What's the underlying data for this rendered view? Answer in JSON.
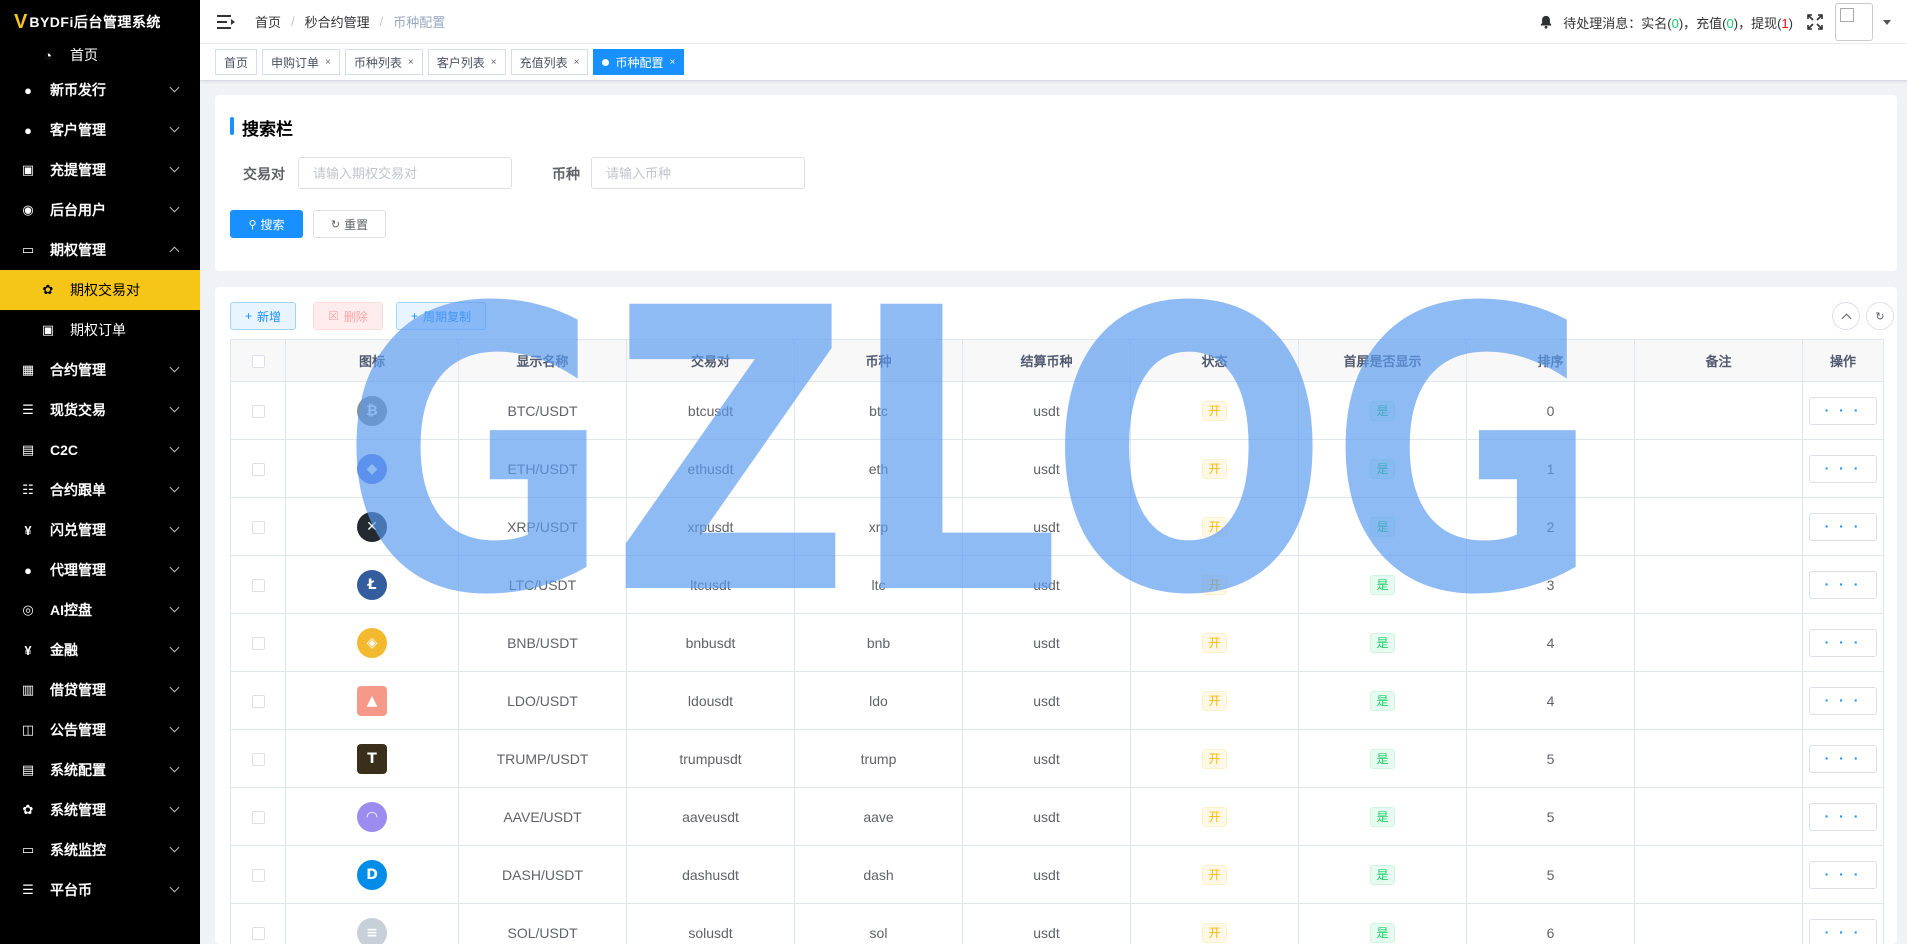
{
  "app": {
    "logo_mark": "V",
    "logo_text": "BYDFi后台管理系统"
  },
  "sidebar": {
    "items": [
      {
        "label": "首页",
        "icon": "dashboard-icon",
        "type": "home"
      },
      {
        "label": "新币发行",
        "icon": "user-icon",
        "type": "group"
      },
      {
        "label": "客户管理",
        "icon": "user-icon",
        "type": "group"
      },
      {
        "label": "充提管理",
        "icon": "copy-icon",
        "type": "group"
      },
      {
        "label": "后台用户",
        "icon": "users-icon",
        "type": "group"
      },
      {
        "label": "期权管理",
        "icon": "monitor-icon",
        "type": "group-open"
      },
      {
        "label": "期权交易对",
        "icon": "gear-icon",
        "type": "active"
      },
      {
        "label": "期权订单",
        "icon": "copy-icon",
        "type": "sub"
      },
      {
        "label": "合约管理",
        "icon": "table-icon",
        "type": "group"
      },
      {
        "label": "现货交易",
        "icon": "list-icon",
        "type": "group"
      },
      {
        "label": "C2C",
        "icon": "document-icon",
        "type": "group"
      },
      {
        "label": "合约跟单",
        "icon": "checklist-icon",
        "type": "group"
      },
      {
        "label": "闪兑管理",
        "icon": "yen-icon",
        "type": "group"
      },
      {
        "label": "代理管理",
        "icon": "user-icon",
        "type": "group"
      },
      {
        "label": "AI控盘",
        "icon": "robot-icon",
        "type": "group"
      },
      {
        "label": "金融",
        "icon": "yen-icon",
        "type": "group"
      },
      {
        "label": "借贷管理",
        "icon": "book-icon",
        "type": "group"
      },
      {
        "label": "公告管理",
        "icon": "open-book-icon",
        "type": "group"
      },
      {
        "label": "系统配置",
        "icon": "document-icon",
        "type": "group"
      },
      {
        "label": "系统管理",
        "icon": "gear-icon",
        "type": "group"
      },
      {
        "label": "系统监控",
        "icon": "monitor-icon",
        "type": "group"
      },
      {
        "label": "平台币",
        "icon": "list-icon",
        "type": "group"
      }
    ]
  },
  "breadcrumb": [
    "首页",
    "秒合约管理",
    "币种配置"
  ],
  "notice": {
    "prefix": "待处理消息：实名(",
    "realname_count": "0",
    "recharge_label": ")，充值(",
    "recharge_count": "0",
    "withdraw_label": ")，提现(",
    "withdraw_count": "1",
    "suffix": ")"
  },
  "tabs": [
    {
      "label": "首页",
      "closable": false,
      "active": false
    },
    {
      "label": "申购订单",
      "closable": true,
      "active": false
    },
    {
      "label": "币种列表",
      "closable": true,
      "active": false
    },
    {
      "label": "客户列表",
      "closable": true,
      "active": false
    },
    {
      "label": "充值列表",
      "closable": true,
      "active": false
    },
    {
      "label": "币种配置",
      "closable": true,
      "active": true
    }
  ],
  "search": {
    "title": "搜索栏",
    "pair_label": "交易对",
    "pair_placeholder": "请输入期权交易对",
    "coin_label": "币种",
    "coin_placeholder": "请输入币种",
    "search_button": "搜索",
    "reset_button": "重置"
  },
  "toolbar": {
    "add_label": "新增",
    "delete_label": "删除",
    "copy_label": "周期复制"
  },
  "table": {
    "columns": [
      "图标",
      "显示名称",
      "交易对",
      "币种",
      "结算币种",
      "状态",
      "首屏是否显示",
      "排序",
      "备注",
      "操作"
    ],
    "rows": [
      {
        "icon": "bitcoin-icon",
        "glyph": "₿",
        "color": "#8e8e8e",
        "name": "BTC/USDT",
        "pair": "btcusdt",
        "coin": "btc",
        "settle": "usdt",
        "status": "开",
        "home": "是",
        "sort": "0",
        "remark": ""
      },
      {
        "icon": "ethereum-icon",
        "glyph": "◆",
        "color": "#627eea",
        "name": "ETH/USDT",
        "pair": "ethusdt",
        "coin": "eth",
        "settle": "usdt",
        "status": "开",
        "home": "是",
        "sort": "1",
        "remark": ""
      },
      {
        "icon": "xrp-icon",
        "glyph": "✕",
        "color": "#23292f",
        "name": "XRP/USDT",
        "pair": "xrpusdt",
        "coin": "xrp",
        "settle": "usdt",
        "status": "开",
        "home": "是",
        "sort": "2",
        "remark": ""
      },
      {
        "icon": "litecoin-icon",
        "glyph": "Ł",
        "color": "#345d9d",
        "name": "LTC/USDT",
        "pair": "ltcusdt",
        "coin": "ltc",
        "settle": "usdt",
        "status": "开",
        "home": "是",
        "sort": "3",
        "remark": ""
      },
      {
        "icon": "bnb-icon",
        "glyph": "◈",
        "color": "#f3ba2f",
        "name": "BNB/USDT",
        "pair": "bnbusdt",
        "coin": "bnb",
        "settle": "usdt",
        "status": "开",
        "home": "是",
        "sort": "4",
        "remark": ""
      },
      {
        "icon": "lido-icon",
        "glyph": "▲",
        "color": "#f69988",
        "name": "LDO/USDT",
        "pair": "ldousdt",
        "coin": "ldo",
        "settle": "usdt",
        "status": "开",
        "home": "是",
        "sort": "4",
        "remark": ""
      },
      {
        "icon": "trump-icon",
        "glyph": "T",
        "color": "#3a2f1a",
        "name": "TRUMP/USDT",
        "pair": "trumpusdt",
        "coin": "trump",
        "settle": "usdt",
        "status": "开",
        "home": "是",
        "sort": "5",
        "remark": ""
      },
      {
        "icon": "aave-icon",
        "glyph": "◠",
        "color": "#9c8cf0",
        "name": "AAVE/USDT",
        "pair": "aaveusdt",
        "coin": "aave",
        "settle": "usdt",
        "status": "开",
        "home": "是",
        "sort": "5",
        "remark": ""
      },
      {
        "icon": "dash-icon",
        "glyph": "D",
        "color": "#008ce7",
        "name": "DASH/USDT",
        "pair": "dashusdt",
        "coin": "dash",
        "settle": "usdt",
        "status": "开",
        "home": "是",
        "sort": "5",
        "remark": ""
      },
      {
        "icon": "solana-icon",
        "glyph": "≡",
        "color": "#c7d0d8",
        "name": "SOL/USDT",
        "pair": "solusdt",
        "coin": "sol",
        "settle": "usdt",
        "status": "开",
        "home": "是",
        "sort": "6",
        "remark": ""
      }
    ],
    "action_label": "· · ·"
  },
  "watermark": {
    "text": "GZLOG",
    "color": "#5a9bf0"
  }
}
